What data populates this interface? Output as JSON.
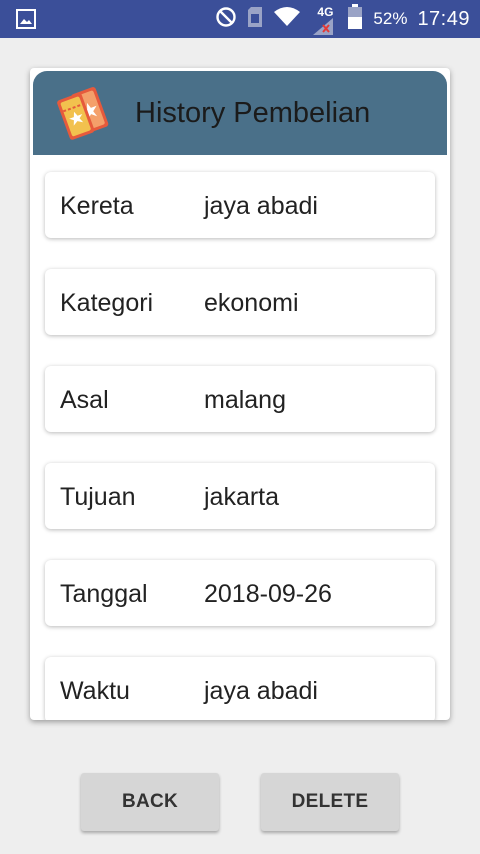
{
  "status_bar": {
    "battery_percent": "52%",
    "time": "17:49",
    "network": "4G",
    "icons": [
      "image-icon",
      "do-not-disturb-icon",
      "sim-card-icon",
      "wifi-icon",
      "signal-icon",
      "battery-icon"
    ]
  },
  "header": {
    "title": "History Pembelian",
    "icon": "ticket-icon",
    "color": "#4a7089"
  },
  "rows": [
    {
      "label": "Kereta",
      "value": "jaya abadi"
    },
    {
      "label": "Kategori",
      "value": "ekonomi"
    },
    {
      "label": "Asal",
      "value": "malang"
    },
    {
      "label": "Tujuan",
      "value": "jakarta"
    },
    {
      "label": "Tanggal",
      "value": "2018-09-26"
    },
    {
      "label": "Waktu",
      "value": "jaya abadi"
    }
  ],
  "buttons": {
    "back_label": "BACK",
    "delete_label": "DELETE"
  },
  "colors": {
    "status_bar": "#3b4f99",
    "background": "#eeeeee",
    "button": "#d6d6d6"
  }
}
